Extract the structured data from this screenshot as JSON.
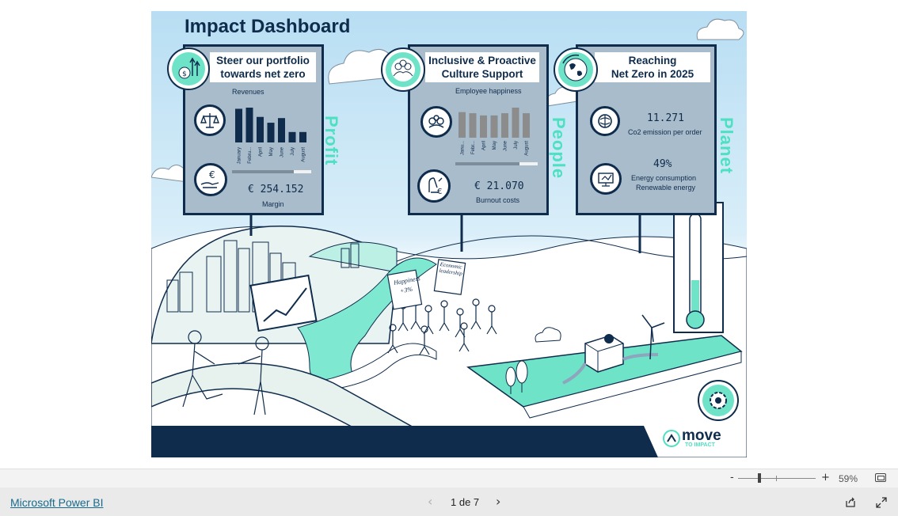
{
  "dashboard": {
    "title": "Impact Dashboard",
    "profit": {
      "title_line1": "Steer our portfolio",
      "title_line2": "towards net zero",
      "side_label": "Profit",
      "revenues": {
        "chart_title": "Revenues",
        "months": [
          "January",
          "Febru...",
          "April",
          "May",
          "June",
          "July",
          "August"
        ],
        "values": [
          58,
          60,
          44,
          34,
          42,
          18,
          18
        ]
      },
      "margin_value": "€ 254.152",
      "margin_label": "Margin"
    },
    "people": {
      "title_line1": "Inclusive & Proactive",
      "title_line2": "Culture Support",
      "side_label": "People",
      "happiness": {
        "chart_title": "Employee happiness",
        "months": [
          "Janu...",
          "Febr...",
          "April",
          "May",
          "June",
          "July",
          "August"
        ],
        "values": [
          46,
          44,
          40,
          40,
          44,
          54,
          44
        ]
      },
      "burnout_value": "€ 21.070",
      "burnout_label": "Burnout costs"
    },
    "planet": {
      "title_line1": "Reaching",
      "title_line2": "Net Zero in 2025",
      "side_label": "Planet",
      "co2_value": "11.271",
      "co2_label": "Co2 emission per order",
      "energy_value": "49%",
      "energy_label_line1": "Energy consumption",
      "energy_label_line2": "Renewable energy"
    },
    "logo_text": "move",
    "logo_subtext": "TO IMPACT",
    "signs": {
      "happiness": "Happiness",
      "happiness_pct": "+3%",
      "economic": "Economic leadership"
    }
  },
  "zoom": {
    "minus": "-",
    "plus": "+",
    "level_text": "59%",
    "level": 0.59
  },
  "footer": {
    "brand_link": "Microsoft Power BI",
    "page_indicator": "1 de 7"
  },
  "colors": {
    "navy": "#0f2c4c",
    "mint": "#4ee0c2",
    "sky": "#c9e7f7",
    "panel": "#a9bccb",
    "bars": "#0f2c4c",
    "bars_people": "#8c8c8c"
  }
}
